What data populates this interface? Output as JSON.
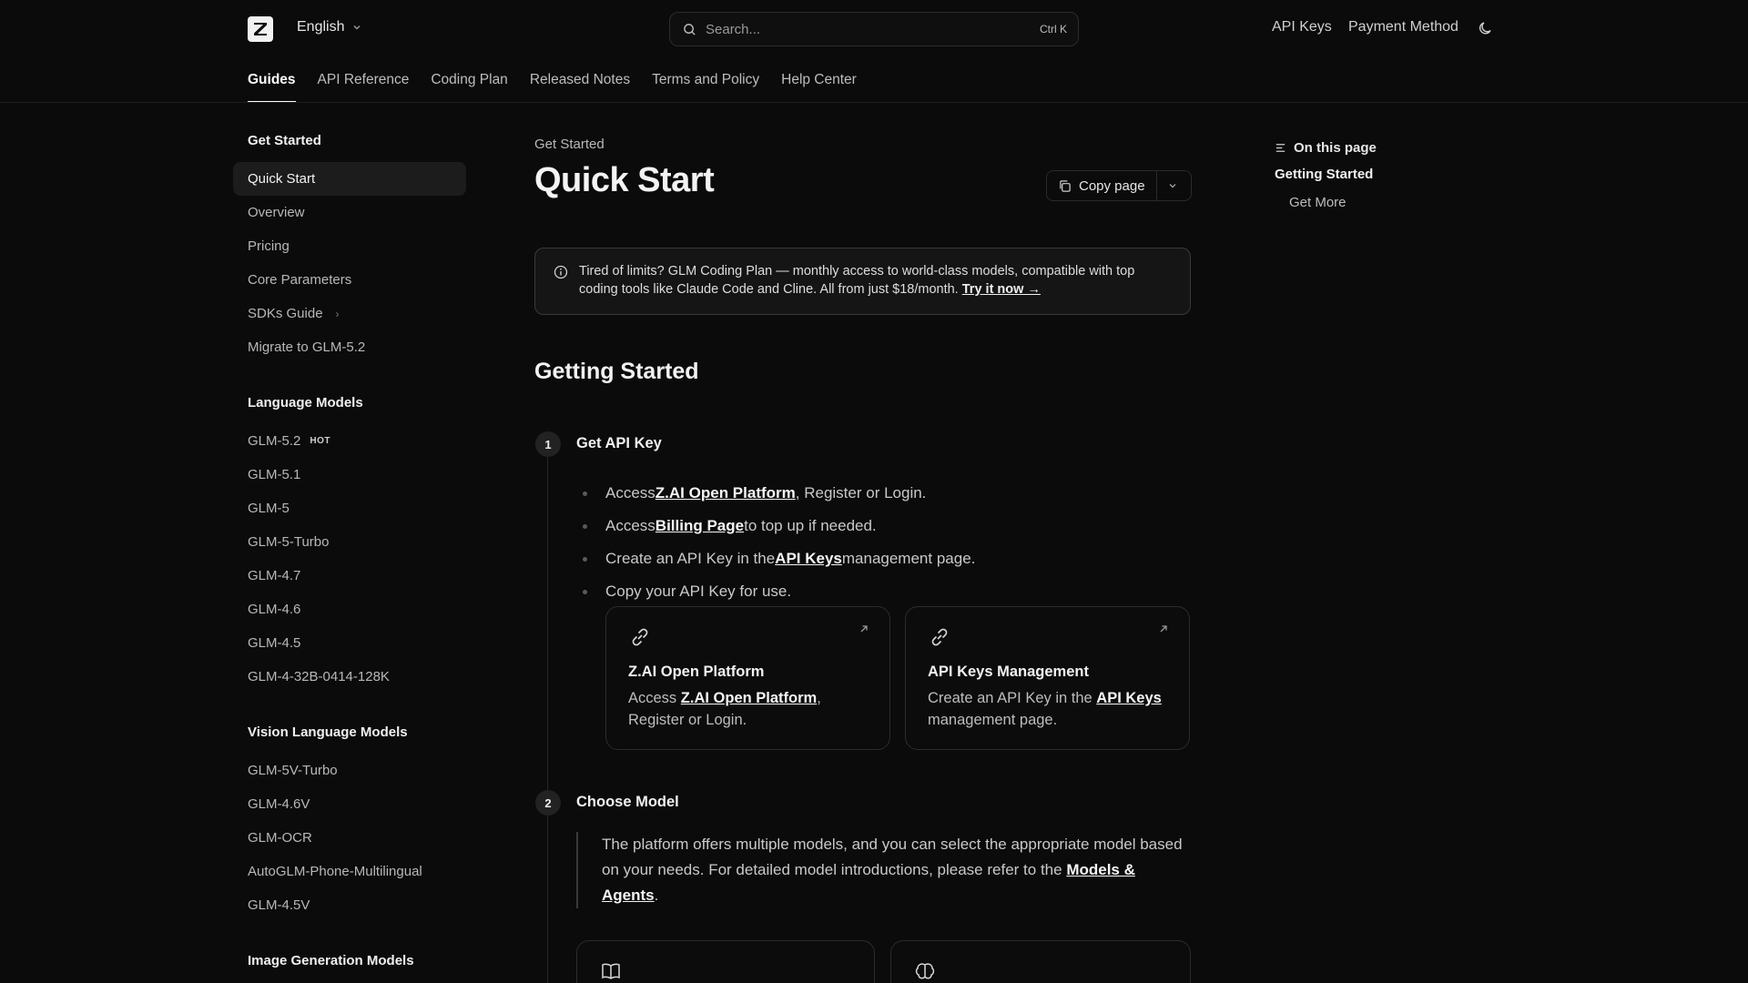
{
  "header": {
    "language": "English",
    "search_placeholder": "Search...",
    "search_shortcut": "Ctrl K",
    "links": [
      "API Keys",
      "Payment Method"
    ]
  },
  "tabs": [
    "Guides",
    "API Reference",
    "Coding Plan",
    "Released Notes",
    "Terms and Policy",
    "Help Center"
  ],
  "active_tab": "Guides",
  "sidebar": {
    "sections": [
      {
        "title": "Get Started",
        "items": [
          "Quick Start",
          "Overview",
          "Pricing",
          "Core Parameters",
          "SDKs Guide",
          "Migrate to GLM-5.2"
        ]
      },
      {
        "title": "Language Models",
        "items": [
          "GLM-5.2",
          "GLM-5.1",
          "GLM-5",
          "GLM-5-Turbo",
          "GLM-4.7",
          "GLM-4.6",
          "GLM-4.5",
          "GLM-4-32B-0414-128K"
        ]
      },
      {
        "title": "Vision Language Models",
        "items": [
          "GLM-5V-Turbo",
          "GLM-4.6V",
          "GLM-OCR",
          "AutoGLM-Phone-Multilingual",
          "GLM-4.5V"
        ]
      },
      {
        "title": "Image Generation Models",
        "items": []
      }
    ],
    "hot_badge": "HOT"
  },
  "main": {
    "eyebrow": "Get Started",
    "title": "Quick Start",
    "copy_page": "Copy page",
    "callout": {
      "text": "Tired of limits? GLM Coding Plan — monthly access to world-class models, compatible with top coding tools like Claude Code and Cline. All from just $18/month.",
      "link": "Try it now →"
    },
    "section_title": "Getting Started",
    "step1": {
      "num": "1",
      "title": "Get API Key",
      "b1_pre": "Access ",
      "b1_link": "Z.AI Open Platform",
      "b1_post": ", Register or Login.",
      "b2_pre": "Access ",
      "b2_link": "Billing Page",
      "b2_post": " to top up if needed.",
      "b3_pre": "Create an API Key in the ",
      "b3_link": "API Keys",
      "b3_post": " management page.",
      "b4": "Copy your API Key for use.",
      "card1": {
        "title": "Z.AI Open Platform",
        "pre": "Access ",
        "link": "Z.AI Open Platform",
        "post": ", Register or Login."
      },
      "card2": {
        "title": "API Keys Management",
        "pre": "Create an API Key in the ",
        "link": "API Keys",
        "post": " management page."
      }
    },
    "step2": {
      "num": "2",
      "title": "Choose Model",
      "quote_pre": "The platform offers multiple models, and you can select the appropriate model based on your needs. For detailed model introductions, please refer to the ",
      "quote_link": "Models & Agents",
      "quote_post": "."
    }
  },
  "toc": {
    "heading": "On this page",
    "items": [
      "Getting Started",
      "Get More"
    ]
  }
}
